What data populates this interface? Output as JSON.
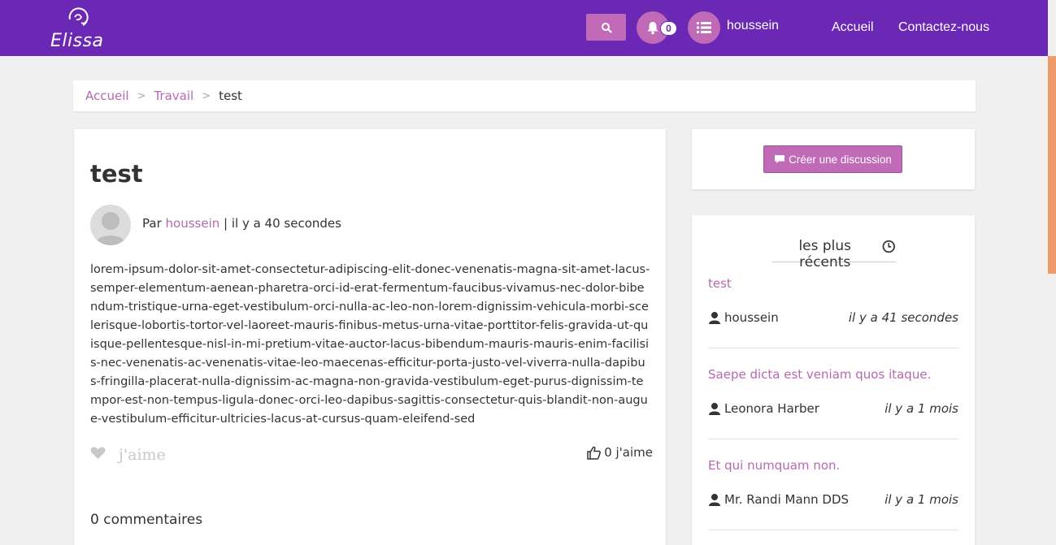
{
  "header": {
    "brand": "Elissa",
    "notifications_count": "0",
    "username": "houssein",
    "nav": [
      "Accueil",
      "Contactez-nous"
    ]
  },
  "breadcrumb": {
    "items": [
      "Accueil",
      "Travail"
    ],
    "current": "test"
  },
  "post": {
    "title": "test",
    "by_prefix": "Par",
    "author": "houssein",
    "time": "| il y a 40 secondes",
    "body": "lorem-ipsum-dolor-sit-amet-consectetur-adipiscing-elit-donec-venenatis-magna-sit-amet-lacus-semper-elementum-aenean-pharetra-orci-id-erat-fermentum-faucibus-vivamus-nec-dolor-bibendum-tristique-urna-eget-vestibulum-orci-nulla-ac-leo-non-lorem-dignissim-vehicula-morbi-scelerisque-lobortis-tortor-vel-laoreet-mauris-finibus-metus-urna-vitae-porttitor-felis-gravida-ut-quisque-pellentesque-nisl-in-mi-pretium-vitae-auctor-lacus-bibendum-mauris-mauris-enim-facilisis-nec-venenatis-ac-venenatis-vitae-leo-maecenas-efficitur-porta-justo-vel-viverra-nulla-dapibus-fringilla-placerat-nulla-dignissim-ac-magna-non-gravida-vestibulum-eget-purus-dignissim-tempor-est-non-tempus-ligula-donec-orci-leo-dapibus-sagittis-consectetur-quis-blandit-non-augue-vestibulum-efficitur-ultricies-lacus-at-cursus-quam-eleifend-sed",
    "like_label": "j'aime",
    "like_count": "0 j'aime",
    "comments": "0 commentaires"
  },
  "sidebar": {
    "create_button": "Créer une discussion",
    "recent_heading": "les plus récents",
    "recent": [
      {
        "title": "test",
        "user": "houssein",
        "time": "il y a 41 secondes"
      },
      {
        "title": "Saepe dicta est veniam quos itaque.",
        "user": "Leonora Harber",
        "time": "il y a 1 mois"
      },
      {
        "title": "Et qui numquam non.",
        "user": "Mr. Randi Mann DDS",
        "time": "il y a 1 mois"
      }
    ]
  },
  "icons": {
    "search": "search-icon",
    "bell": "bell-icon",
    "menu": "list-icon",
    "heart": "heart-icon",
    "thumbs_up": "thumbs-up-icon",
    "comment": "comment-icon",
    "clock": "clock-icon",
    "user": "user-icon"
  },
  "colors": {
    "header": "#6b28b5",
    "accent": "#c06ab8",
    "link": "#b768b3"
  }
}
